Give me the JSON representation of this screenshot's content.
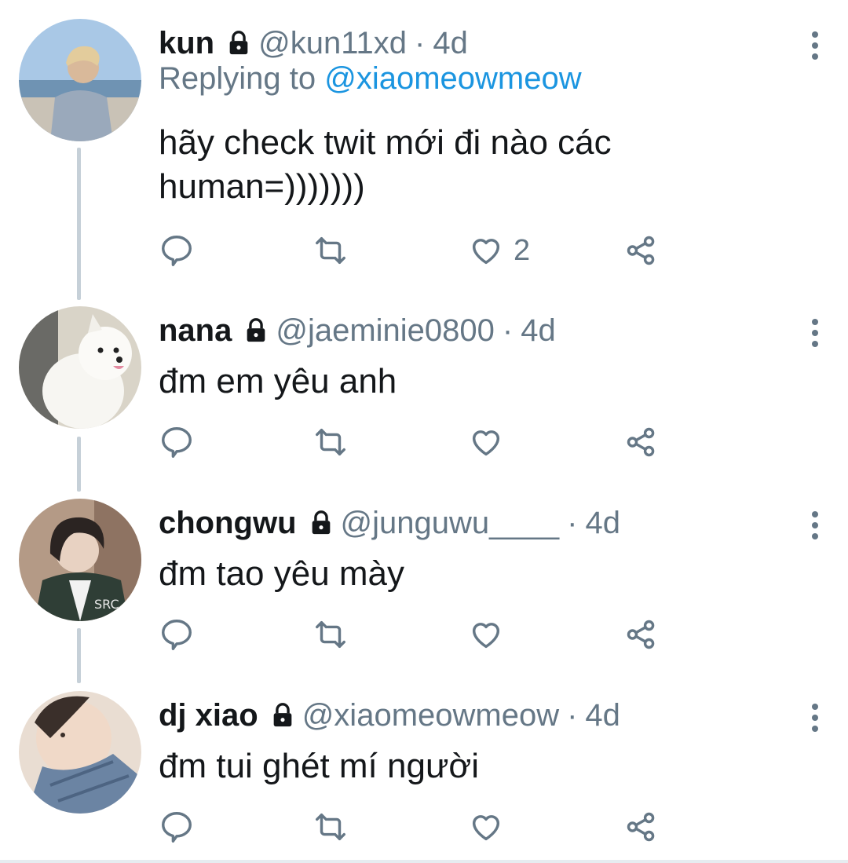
{
  "tweets": [
    {
      "name": "kun",
      "handle": "@kun11xd",
      "separator": "·",
      "time": "4d",
      "replying_prefix": "Replying to",
      "replying_to": "@xiaomeowmeow",
      "text": "hãy check twit mới đi nào các human=)))))))",
      "likes": "2",
      "avatar": "avatar-beach-person"
    },
    {
      "name": "nana",
      "handle": "@jaeminie0800",
      "separator": "·",
      "time": "4d",
      "text": "đm em yêu anh",
      "likes": "",
      "avatar": "avatar-white-dog"
    },
    {
      "name": "chongwu",
      "handle": "@junguwu____",
      "separator": "·",
      "time": "4d",
      "text": "đm tao yêu mày",
      "likes": "",
      "avatar": "avatar-dark-hair-jacket"
    },
    {
      "name": "dj xiao",
      "handle": "@xiaomeowmeow",
      "separator": "·",
      "time": "4d",
      "text": "đm tui ghét mí người",
      "likes": "",
      "avatar": "avatar-face-closeup"
    }
  ],
  "icons": {
    "lock": "lock-icon",
    "reply": "reply-icon",
    "retweet": "retweet-icon",
    "like": "heart-icon",
    "share": "share-icon",
    "more": "more-vertical-icon"
  },
  "colors": {
    "text": "#14171a",
    "secondary": "#657786",
    "link": "#1b95e0",
    "thread_line": "#c6d0d8"
  }
}
